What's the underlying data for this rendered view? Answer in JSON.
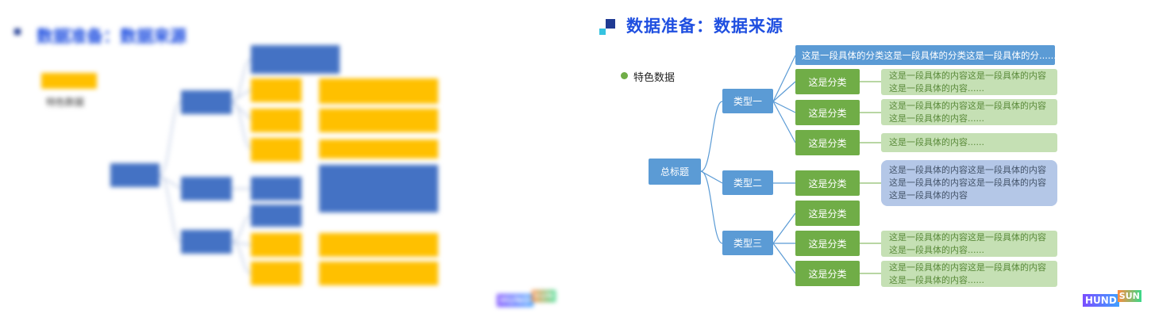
{
  "left": {
    "title": "数据准备：数据来源",
    "legend_label": "特色数据",
    "colors": {
      "blue": "#4472c4",
      "orange": "#ffc000",
      "red_text": "#c00000"
    }
  },
  "right": {
    "title": "数据准备：数据来源",
    "bullet_label": "特色数据",
    "root": "总标题",
    "top_note": "这是一段具体的分类这是一段具体的分类这是一段具体的分......",
    "types": [
      "类型一",
      "类型二",
      "类型三"
    ],
    "categories": [
      {
        "label": "这是分类",
        "desc": "这是一段具体的内容这是一段具体的内容这是一段具体的内容......"
      },
      {
        "label": "这是分类",
        "desc": "这是一段具体的内容这是一段具体的内容这是一段具体的内容......"
      },
      {
        "label": "这是分类",
        "desc": "这是一段具体的内容......"
      },
      {
        "label": "这是分类",
        "desc": "这是一段具体的内容这是一段具体的内容这是一段具体的内容这是一段具体的内容这是一段具体的内容"
      },
      {
        "label": "这是分类",
        "desc": ""
      },
      {
        "label": "这是分类",
        "desc": "这是一段具体的内容这是一段具体的内容这是一段具体的内容......"
      },
      {
        "label": "这是分类",
        "desc": "这是一段具体的内容这是一段具体的内容这是一段具体的内容......"
      }
    ],
    "colors": {
      "title": "#1f4fe0",
      "node_blue": "#5b9bd5",
      "node_green": "#70ad47",
      "desc_green": "#c5e0b4",
      "desc_blue": "#b4c7e7",
      "connector": "#5b9bd5"
    }
  },
  "logo": {
    "main": "HUND",
    "sup": "SUN"
  }
}
